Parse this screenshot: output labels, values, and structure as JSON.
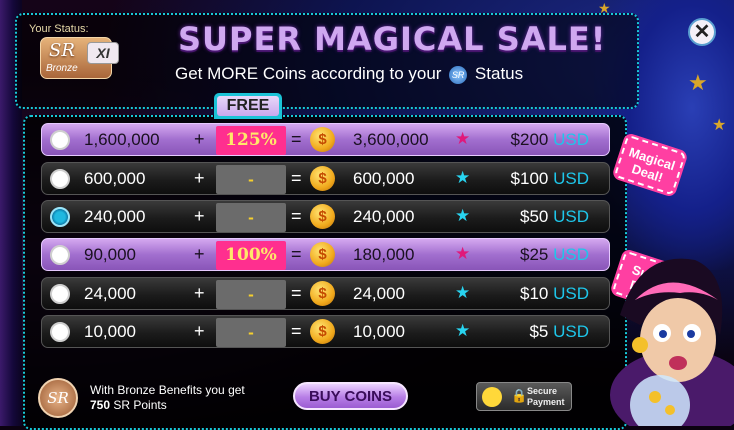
{
  "header": {
    "status_label": "Your Status:",
    "badge": {
      "logo_text": "SR",
      "tier": "Bronze",
      "level": "XI"
    },
    "title": "SUPER MAGICAL SALE!",
    "subtitle_before": "Get MORE Coins according to your",
    "subtitle_logo": "SR",
    "subtitle_after": "Status",
    "close_icon": "close-icon"
  },
  "free_label": "FREE",
  "packages": [
    {
      "base": "1,600,000",
      "bonus": "125%",
      "total": "3,600,000",
      "price": "$200",
      "currency": "USD",
      "style": "purple",
      "star_color": "#e0187a",
      "selected": false
    },
    {
      "base": "600,000",
      "bonus": "-",
      "total": "600,000",
      "price": "$100",
      "currency": "USD",
      "style": "dark",
      "star_color": "#28d4f0",
      "selected": false
    },
    {
      "base": "240,000",
      "bonus": "-",
      "total": "240,000",
      "price": "$50",
      "currency": "USD",
      "style": "dark",
      "star_color": "#28d4f0",
      "selected": true
    },
    {
      "base": "90,000",
      "bonus": "100%",
      "total": "180,000",
      "price": "$25",
      "currency": "USD",
      "style": "purple",
      "star_color": "#e0187a",
      "selected": false
    },
    {
      "base": "24,000",
      "bonus": "-",
      "total": "24,000",
      "price": "$10",
      "currency": "USD",
      "style": "dark",
      "star_color": "#28d4f0",
      "selected": false
    },
    {
      "base": "10,000",
      "bonus": "-",
      "total": "10,000",
      "price": "$5",
      "currency": "USD",
      "style": "dark",
      "star_color": "#28d4f0",
      "selected": false
    }
  ],
  "symbols": {
    "plus": "+",
    "equals": "=",
    "coin": "$",
    "star": "★"
  },
  "tags": {
    "magical": "Magical Deal!",
    "super": "Super Deal!"
  },
  "footer": {
    "badge_text": "SR",
    "benefit_line1": "With Bronze Benefits you get",
    "benefit_points": "750",
    "benefit_suffix": "SR Points",
    "buy_label": "BUY COINS",
    "secure_line1": "Secure",
    "secure_line2": "Payment"
  },
  "colors": {
    "accent": "#18c8d8",
    "purple": "#b77ee6",
    "pink": "#ff2f8f",
    "usd": "#1ec6ea"
  }
}
